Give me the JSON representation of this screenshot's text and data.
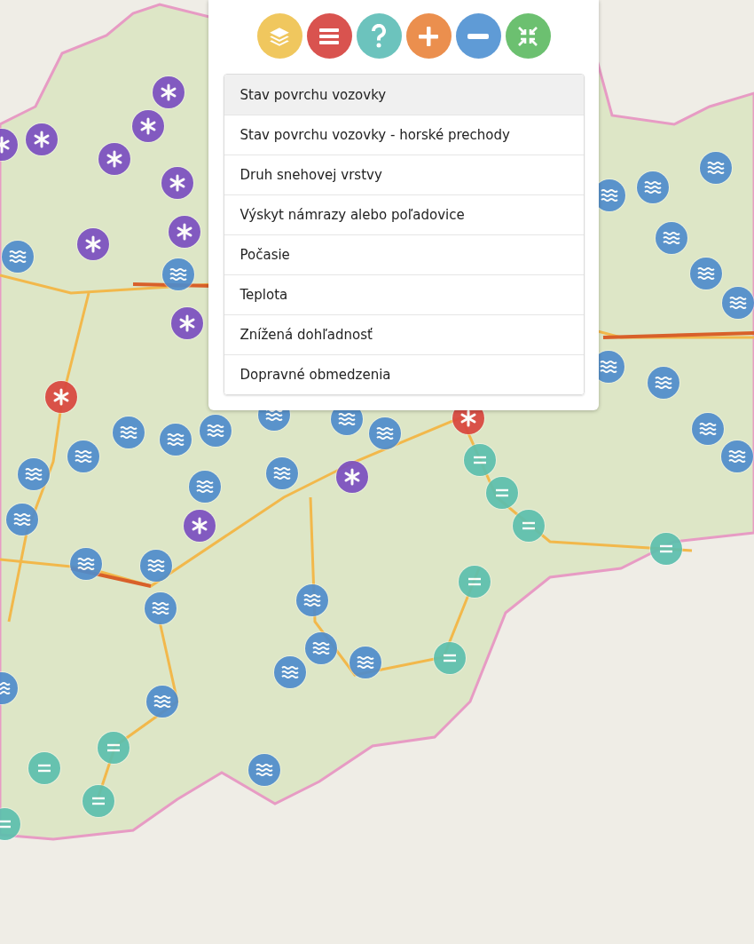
{
  "toolbar": [
    {
      "kind": "layers",
      "color": "#f0c75e"
    },
    {
      "kind": "menu",
      "color": "#d9534f"
    },
    {
      "kind": "help",
      "color": "#6cc3bd"
    },
    {
      "kind": "zoom_in",
      "color": "#eb8f4e"
    },
    {
      "kind": "zoom_out",
      "color": "#5f9bd6"
    },
    {
      "kind": "collapse",
      "color": "#6cc070"
    }
  ],
  "layer_menu": [
    {
      "label": "Stav povrchu vozovky",
      "selected": true
    },
    {
      "label": "Stav povrchu vozovky - horské prechody",
      "selected": false
    },
    {
      "label": "Druh snehovej vrstvy",
      "selected": false
    },
    {
      "label": "Výskyt námrazy alebo poľadovice",
      "selected": false
    },
    {
      "label": "Počasie",
      "selected": false
    },
    {
      "label": "Teplota",
      "selected": false
    },
    {
      "label": "Znížená dohľadnosť",
      "selected": false
    },
    {
      "label": "Dopravné obmedzenia",
      "selected": false
    }
  ],
  "markers": [
    {
      "kind": "snow"
    },
    {
      "kind": "snow"
    },
    {
      "kind": "snow"
    },
    {
      "kind": "snow"
    },
    {
      "kind": "snow"
    },
    {
      "kind": "snow"
    },
    {
      "kind": "snow"
    },
    {
      "kind": "snow"
    },
    {
      "kind": "snow"
    },
    {
      "kind": "snow"
    },
    {
      "kind": "snow"
    },
    {
      "kind": "ice"
    },
    {
      "kind": "ice"
    },
    {
      "kind": "wet"
    },
    {
      "kind": "wet"
    },
    {
      "kind": "wet"
    },
    {
      "kind": "wet"
    },
    {
      "kind": "wet"
    },
    {
      "kind": "wet"
    },
    {
      "kind": "wet"
    },
    {
      "kind": "wet"
    },
    {
      "kind": "wet"
    },
    {
      "kind": "wet"
    },
    {
      "kind": "wet"
    },
    {
      "kind": "wet"
    },
    {
      "kind": "wet"
    },
    {
      "kind": "wet"
    },
    {
      "kind": "wet"
    },
    {
      "kind": "wet"
    },
    {
      "kind": "wet"
    },
    {
      "kind": "wet"
    },
    {
      "kind": "wet"
    },
    {
      "kind": "wet"
    },
    {
      "kind": "wet"
    },
    {
      "kind": "wet"
    },
    {
      "kind": "wet"
    },
    {
      "kind": "wet"
    },
    {
      "kind": "wet"
    },
    {
      "kind": "wet"
    },
    {
      "kind": "wet"
    },
    {
      "kind": "wet"
    },
    {
      "kind": "wet"
    },
    {
      "kind": "wet"
    },
    {
      "kind": "wet"
    },
    {
      "kind": "wet"
    },
    {
      "kind": "wet"
    },
    {
      "kind": "dry"
    },
    {
      "kind": "dry"
    },
    {
      "kind": "dry"
    },
    {
      "kind": "dry"
    },
    {
      "kind": "dry"
    },
    {
      "kind": "dry"
    },
    {
      "kind": "dry"
    },
    {
      "kind": "dry"
    },
    {
      "kind": "dry"
    },
    {
      "kind": "dry"
    }
  ]
}
